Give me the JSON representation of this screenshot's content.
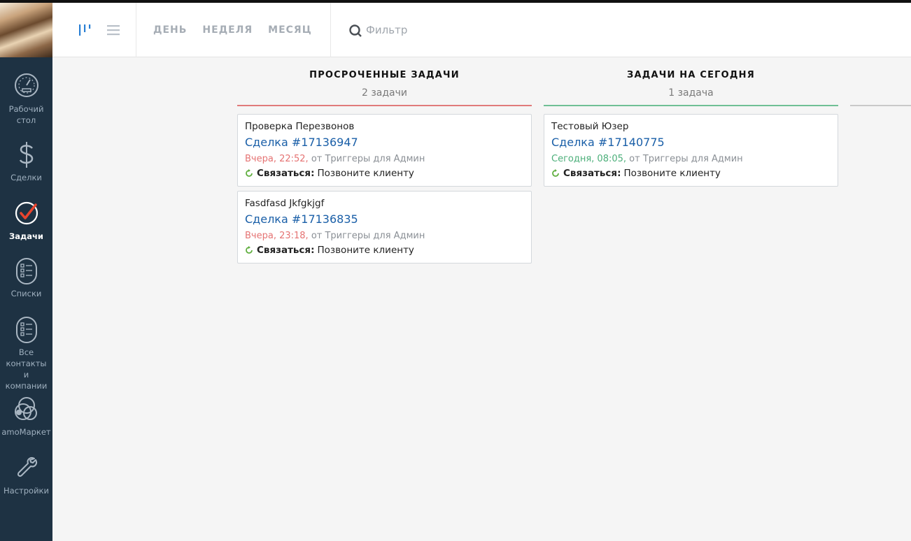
{
  "sidebar": {
    "items": [
      {
        "label": "Рабочий стол",
        "icon": "dashboard-gauge-icon",
        "active": false
      },
      {
        "label": "Сделки",
        "icon": "dollar-icon",
        "active": false
      },
      {
        "label": "Задачи",
        "icon": "checkmark-circle-icon",
        "active": true
      },
      {
        "label": "Списки",
        "icon": "list-icon",
        "active": false
      },
      {
        "label": "Все контакты и компании",
        "icon": "contacts-list-icon",
        "active": false
      },
      {
        "label": "amoМаркет",
        "icon": "market-icon",
        "active": false
      },
      {
        "label": "Настройки",
        "icon": "wrench-icon",
        "active": false
      }
    ]
  },
  "header": {
    "view_modes": [
      "pipeline-view",
      "list-view"
    ],
    "periods": [
      "ДЕНЬ",
      "НЕДЕЛЯ",
      "МЕСЯЦ"
    ],
    "filter_placeholder": "Фильтр"
  },
  "colors": {
    "overdue_line": "#e07b7b",
    "today_line": "#6fbf95",
    "lead_link": "#1a5fa8",
    "overdue_time": "#e57373",
    "today_time": "#4caf7a",
    "active_nav_icon": "#e8442e"
  },
  "columns": [
    {
      "title": "ПРОСРОЧЕННЫЕ ЗАДАЧИ",
      "count": "2 задачи",
      "cards": [
        {
          "contact": "Проверка Перезвонов",
          "lead": "Сделка #17136947",
          "time": "Вчера, 22:52,",
          "meta": "от Триггеры  для Админ",
          "task_type": "Связаться:",
          "task_text": "Позвоните клиенту"
        },
        {
          "contact": "Fasdfasd Jkfgkjgf",
          "lead": "Сделка #17136835",
          "time": "Вчера, 23:18,",
          "meta": "от Триггеры  для Админ",
          "task_type": "Связаться:",
          "task_text": "Позвоните клиенту"
        }
      ]
    },
    {
      "title": "ЗАДАЧИ НА СЕГОДНЯ",
      "count": "1 задача",
      "cards": [
        {
          "contact": "Тестовый Юзер",
          "lead": "Сделка #17140775",
          "time": "Сегодня, 08:05,",
          "meta": "от Триггеры  для Админ",
          "task_type": "Связаться:",
          "task_text": "Позвоните клиенту"
        }
      ]
    }
  ]
}
